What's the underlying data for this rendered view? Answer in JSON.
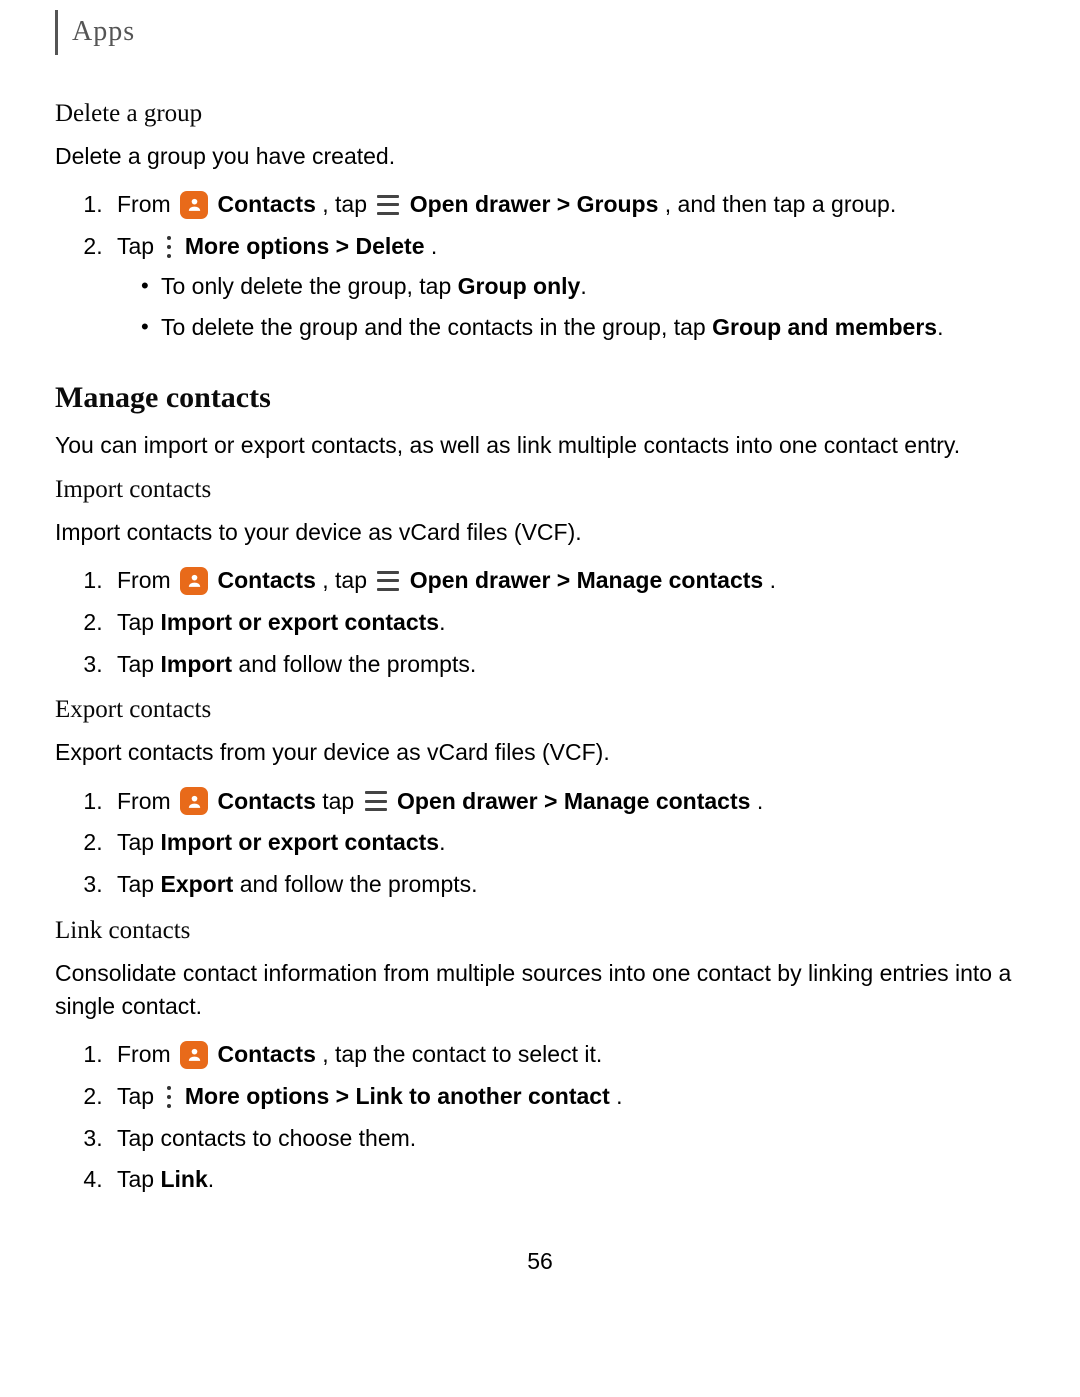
{
  "section": "Apps",
  "delete_group": {
    "title": "Delete a group",
    "intro": "Delete a group you have created.",
    "step1_from": "From ",
    "step1_contacts": " Contacts",
    "step1_tap": ", tap ",
    "step1_open": " Open drawer > Groups",
    "step1_rest": ", and then tap a group.",
    "step2_tap": "Tap ",
    "step2_more": " More options > Delete",
    "step2_end": ".",
    "bullet1_a": "To only delete the group, tap ",
    "bullet1_b": "Group only",
    "bullet1_c": ".",
    "bullet2_a": "To delete the group and the contacts in the group, tap ",
    "bullet2_b": "Group and members",
    "bullet2_c": "."
  },
  "manage_contacts": {
    "title": "Manage contacts",
    "intro": "You can import or export contacts, as well as link multiple contacts into one contact entry."
  },
  "import_contacts": {
    "title": "Import contacts",
    "intro": "Import contacts to your device as vCard files (VCF).",
    "s1_from": "From ",
    "s1_contacts": " Contacts",
    "s1_tap": ", tap ",
    "s1_open": " Open drawer > Manage contacts",
    "s1_end": ".",
    "s2_a": "Tap ",
    "s2_b": "Import or export contacts",
    "s2_c": ".",
    "s3_a": "Tap ",
    "s3_b": "Import",
    "s3_c": " and follow the prompts."
  },
  "export_contacts": {
    "title": "Export contacts",
    "intro": "Export contacts from your device as vCard files (VCF).",
    "s1_from": "From ",
    "s1_contacts": " Contacts",
    "s1_tap": " tap ",
    "s1_open": " Open drawer > Manage contacts",
    "s1_end": ".",
    "s2_a": "Tap ",
    "s2_b": "Import or export contacts",
    "s2_c": ".",
    "s3_a": "Tap ",
    "s3_b": "Export",
    "s3_c": " and follow the prompts."
  },
  "link_contacts": {
    "title": "Link contacts",
    "intro": "Consolidate contact information from multiple sources into one contact by linking entries into a single contact.",
    "s1_from": "From ",
    "s1_contacts": " Contacts",
    "s1_rest": ", tap the contact to select it.",
    "s2_tap": "Tap ",
    "s2_more": " More options > Link to another contact",
    "s2_end": ".",
    "s3": "Tap contacts to choose them.",
    "s4_a": "Tap ",
    "s4_b": "Link",
    "s4_c": "."
  },
  "page_number": "56"
}
